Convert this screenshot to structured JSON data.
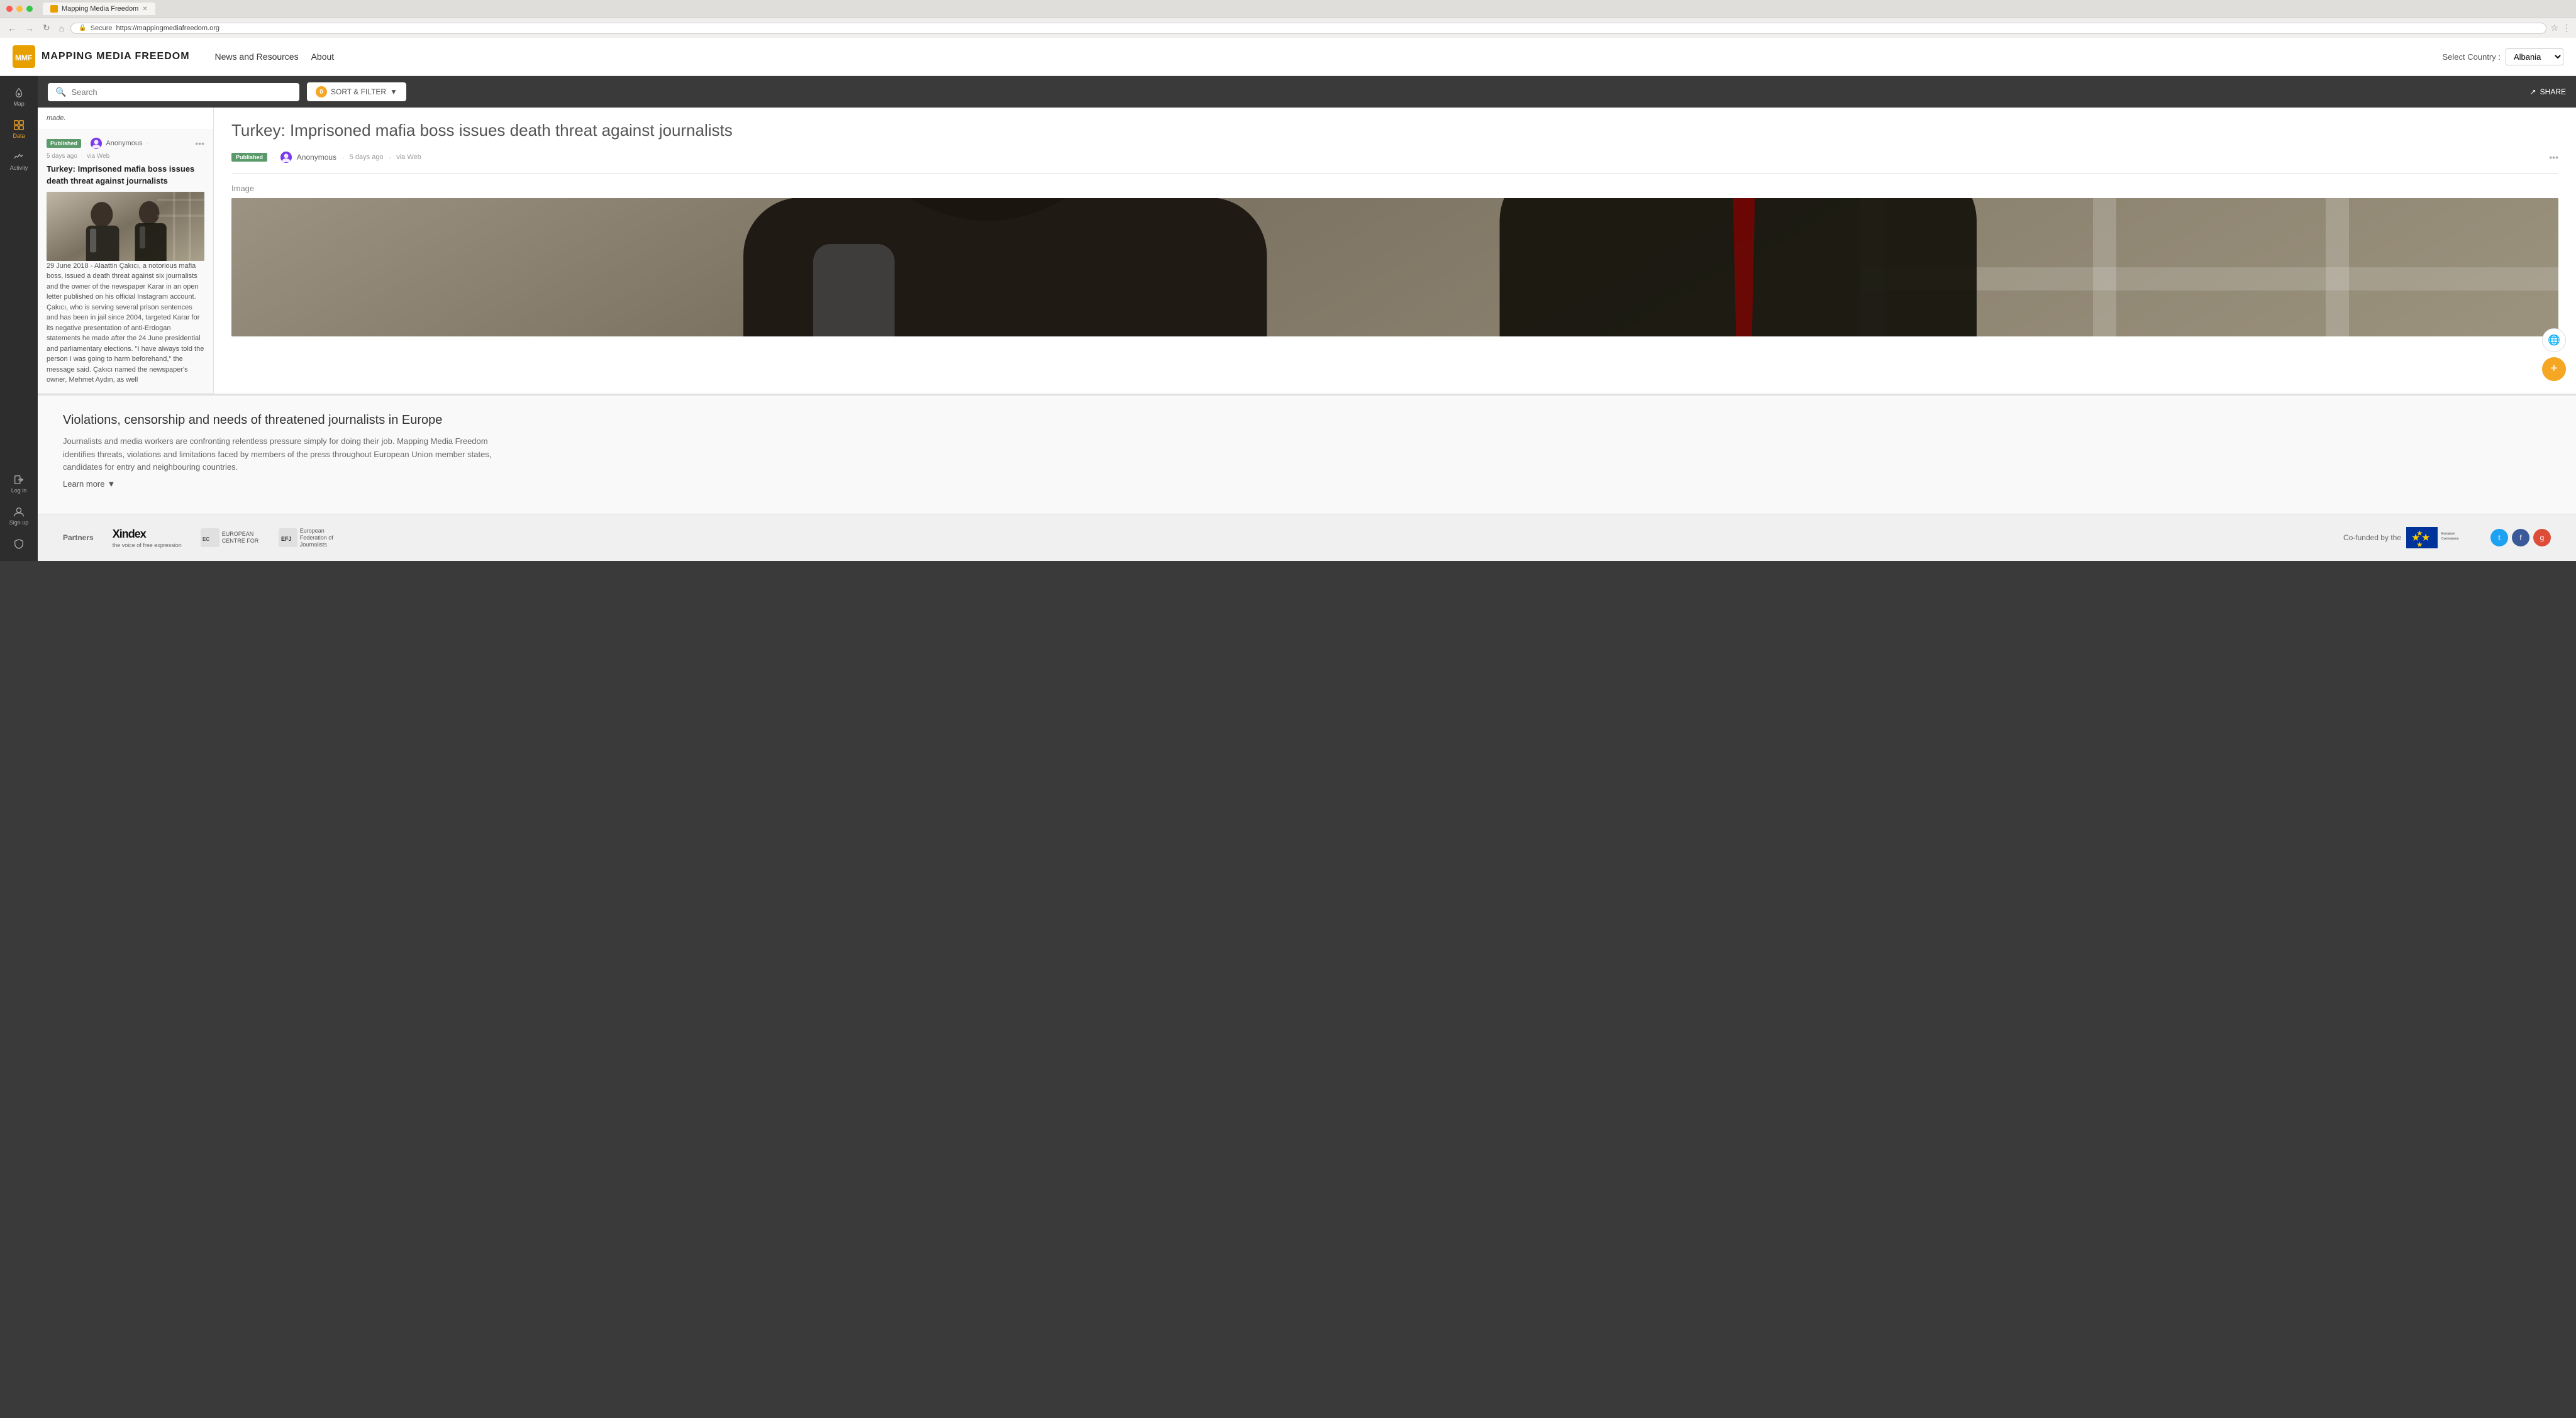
{
  "browser": {
    "tab_title": "Mapping Media Freedom",
    "url": "https://mappingmediafreedom.org",
    "secure_label": "Secure"
  },
  "nav": {
    "site_title": "MAPPING MEDIA FREEDOM",
    "links": [
      {
        "label": "News and Resources",
        "id": "news"
      },
      {
        "label": "About",
        "id": "about"
      }
    ],
    "country_select_label": "Select Country :",
    "country_selected": "Albania"
  },
  "sidebar": {
    "items": [
      {
        "label": "Map",
        "icon": "map-icon",
        "active": false
      },
      {
        "label": "Data",
        "icon": "data-icon",
        "active": true
      },
      {
        "label": "Activity",
        "icon": "activity-icon",
        "active": false
      }
    ],
    "bottom_items": [
      {
        "label": "Log in",
        "icon": "login-icon"
      },
      {
        "label": "Sign up",
        "icon": "signup-icon"
      },
      {
        "label": "",
        "icon": "shield-icon"
      }
    ]
  },
  "search_bar": {
    "placeholder": "Search",
    "filter_count": "0",
    "sort_filter_label": "SORT & FILTER",
    "share_label": "SHARE"
  },
  "truncated_card": {
    "text": "made."
  },
  "article_card": {
    "published_label": "Published",
    "author": "Anonymous",
    "time_ago": "5 days ago",
    "via": "via Web",
    "title": "Turkey: Imprisoned mafia boss issues death threat against journalists",
    "excerpt": "29 June 2018 - Alaattin Çakıcı, a notorious mafia boss, issued a death threat against six journalists and the owner of the newspaper Karar in an open letter published on his official Instagram account. Çakıcı, who is serving several prison sentences and has been in jail since 2004, targeted Karar for its negative presentation of anti-Erdogan statements he made after the 24 June presidential and parliamentary elections. \"I have always told the person I was going to harm beforehand,\" the message said. Çakıcı named the newspaper's owner, Mehmet Aydın, as well"
  },
  "detail": {
    "title": "Turkey: Imprisoned mafia boss issues death threat against journalists",
    "published_label": "Published",
    "author": "Anonymous",
    "time_ago": "5 days ago",
    "via": "via Web",
    "image_label": "Image"
  },
  "bottom_section": {
    "title": "Violations, censorship and needs of threatened journalists in Europe",
    "description": "Journalists and media workers are confronting relentless pressure simply for doing their job. Mapping Media Freedom identifies threats, violations and limitations faced by members of the press throughout European Union member states, candidates for entry and neighbouring countries.",
    "learn_more_label": "Learn more"
  },
  "partners_section": {
    "label": "Partners",
    "cofunded_label": "Co-funded by the",
    "partner1": "Xindex",
    "partner1_subtitle": "the voice of free expression",
    "social_icons": [
      "twitter",
      "facebook",
      "google-plus"
    ]
  },
  "float_buttons": {
    "globe_label": "🌐",
    "plus_label": "+"
  }
}
